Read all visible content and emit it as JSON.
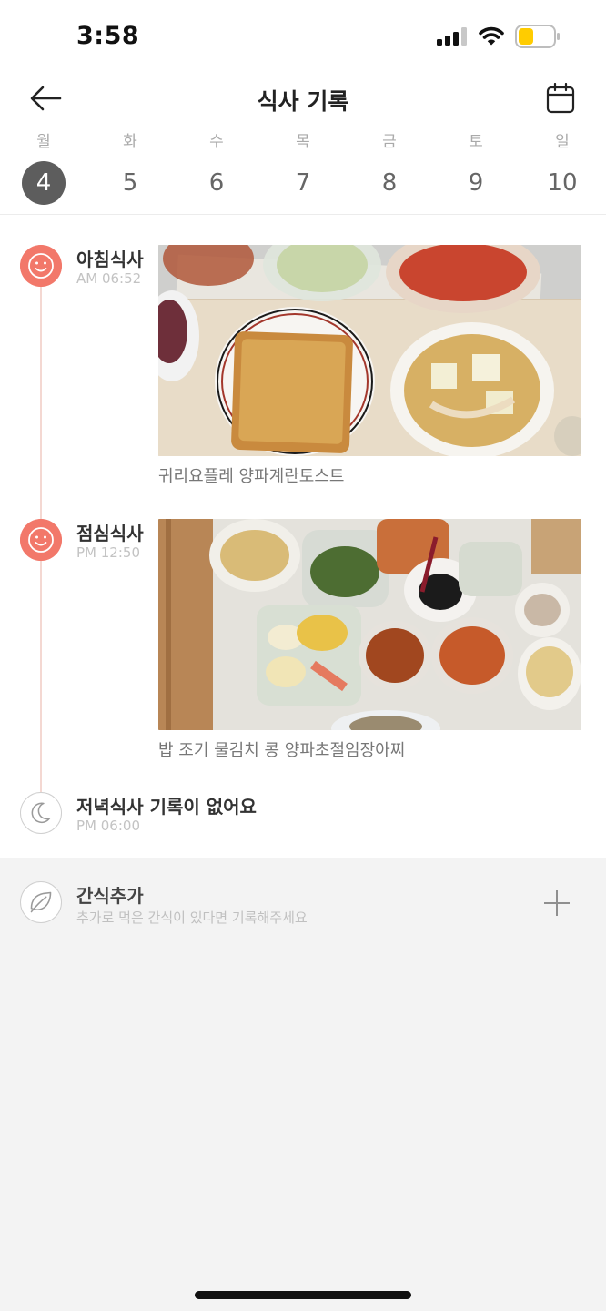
{
  "status_bar": {
    "time": "3:58"
  },
  "header": {
    "title": "식사 기록"
  },
  "week": {
    "days": [
      {
        "name": "월",
        "date": "4",
        "selected": true
      },
      {
        "name": "화",
        "date": "5"
      },
      {
        "name": "수",
        "date": "6"
      },
      {
        "name": "목",
        "date": "7"
      },
      {
        "name": "금",
        "date": "8"
      },
      {
        "name": "토",
        "date": "9"
      },
      {
        "name": "일",
        "date": "10"
      }
    ]
  },
  "meals": {
    "breakfast": {
      "name": "아침식사",
      "time": "AM 06:52",
      "caption": "귀리요플레 양파계란토스트"
    },
    "lunch": {
      "name": "점심식사",
      "time": "PM 12:50",
      "caption": "밥 조기 물김치 콩 양파초절임장아찌"
    },
    "dinner": {
      "name": "저녁식사 기록이 없어요",
      "time": "PM 06:00"
    }
  },
  "snack": {
    "title": "간식추가",
    "subtitle": "추가로 먹은 간식이 있다면 기록해주세요"
  },
  "colors": {
    "accent": "#f2786a",
    "selected_day": "#5d5d5d",
    "background": "#f3f3f3"
  },
  "icons": [
    "back-arrow-icon",
    "calendar-icon",
    "smile-icon",
    "moon-icon",
    "leaf-icon",
    "plus-icon",
    "signal-icon",
    "wifi-icon",
    "battery-icon"
  ]
}
